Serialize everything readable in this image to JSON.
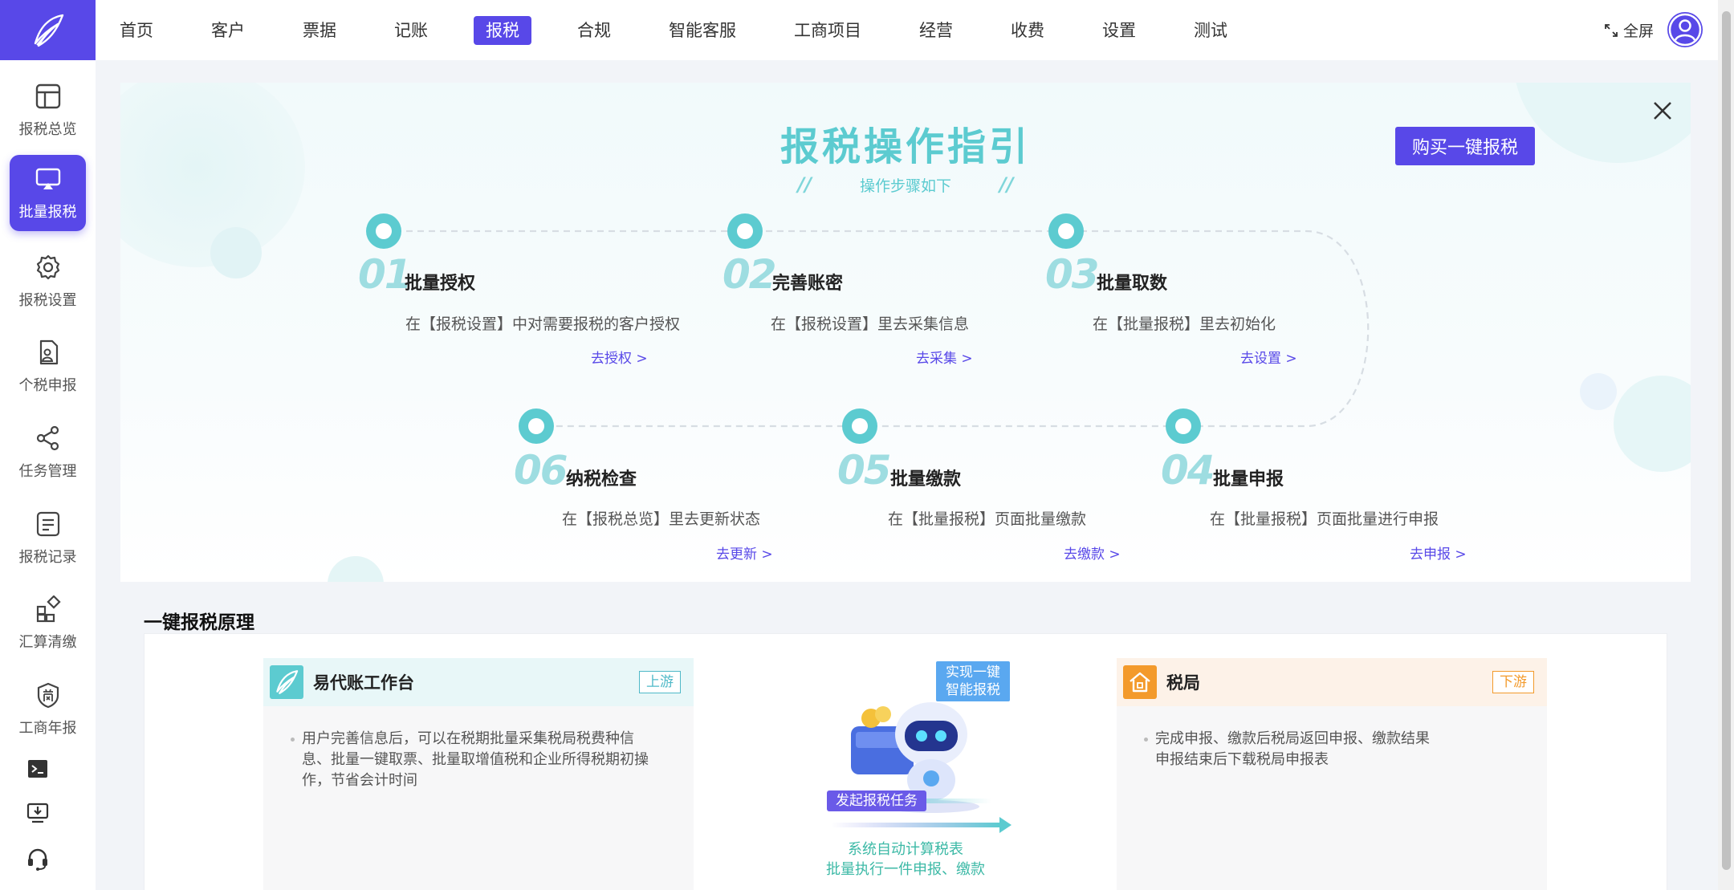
{
  "nav": {
    "items": [
      "首页",
      "客户",
      "票据",
      "记账",
      "报税",
      "合规",
      "智能客服",
      "工商项目",
      "经营",
      "收费",
      "设置",
      "测试"
    ],
    "active": "报税",
    "fullscreen_label": "全屏"
  },
  "sidebar": {
    "items": [
      {
        "label": "报税总览",
        "icon": "layout-icon"
      },
      {
        "label": "批量报税",
        "icon": "screen-icon"
      },
      {
        "label": "报税设置",
        "icon": "gear-icon"
      },
      {
        "label": "个税申报",
        "icon": "person-doc-icon"
      },
      {
        "label": "任务管理",
        "icon": "share-icon"
      },
      {
        "label": "报税记录",
        "icon": "list-icon"
      },
      {
        "label": "汇算清缴",
        "icon": "grid-icon"
      },
      {
        "label": "工商年报",
        "icon": "shop-badge-icon"
      }
    ],
    "active": "批量报税",
    "extra_icons": [
      "terminal-icon",
      "download-screen-icon",
      "headset-icon"
    ]
  },
  "guide": {
    "title": "报税操作指引",
    "subtitle": "操作步骤如下",
    "buy_button": "购买一键报税",
    "steps": [
      {
        "num": "01",
        "title": "批量授权",
        "desc": "在【报税设置】中对需要报税的客户授权",
        "link": "去授权 >"
      },
      {
        "num": "02",
        "title": "完善账密",
        "desc": "在【报税设置】里去采集信息",
        "link": "去采集 >"
      },
      {
        "num": "03",
        "title": "批量取数",
        "desc": "在【批量报税】里去初始化",
        "link": "去设置 >"
      },
      {
        "num": "04",
        "title": "批量申报",
        "desc": "在【批量报税】页面批量进行申报",
        "link": "去申报 >"
      },
      {
        "num": "05",
        "title": "批量缴款",
        "desc": "在【批量报税】页面批量缴款",
        "link": "去缴款 >"
      },
      {
        "num": "06",
        "title": "纳税检查",
        "desc": "在【报税总览】里去更新状态",
        "link": "去更新 >"
      }
    ]
  },
  "principle": {
    "title": "一键报税原理",
    "left_card": {
      "title": "易代账工作台",
      "tag": "上游",
      "text": "用户完善信息后，可以在税期批量采集税局税费种信息、批量一键取票、批量取增值税和企业所得税期初操作，节省会计时间"
    },
    "center": {
      "tag_line1": "实现一键",
      "tag_line2": "智能报税",
      "start_task": "发起报税任务",
      "auto_line1": "系统自动计算税表",
      "auto_line2": "批量执行一件申报、缴款"
    },
    "right_card": {
      "title": "税局",
      "tag": "下游",
      "line1": "完成申报、缴款后税局返回申报、缴款结果",
      "line2": "申报结束后下载税局申报表"
    }
  },
  "colors": {
    "brand": "#5848e8",
    "teal": "#5ccbd0",
    "upstream_tag": "#4fb9c8",
    "downstream_tag": "#f39a2b"
  }
}
